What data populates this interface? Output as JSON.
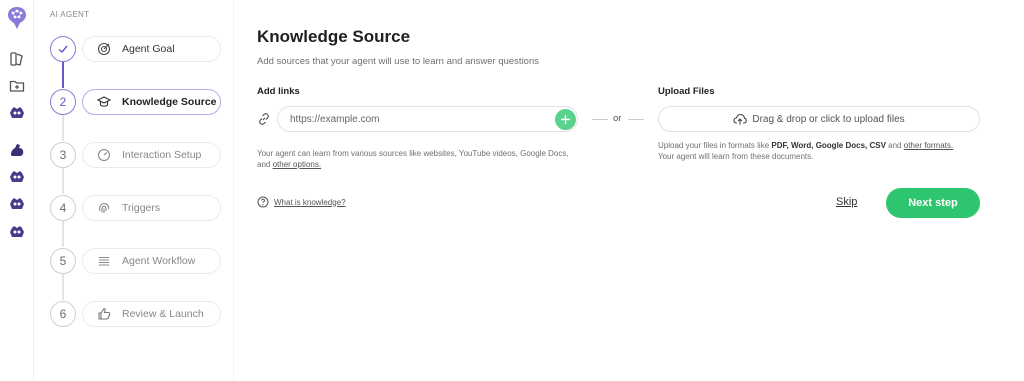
{
  "app": {
    "section_label": "AI AGENT",
    "logo_icon": "brain-logo-icon",
    "accent_color": "#6a55c9",
    "success_color": "#2ec56f"
  },
  "rail": {
    "icons": [
      "book-icon",
      "folder-plus-icon",
      "agent-avatar-icon",
      "flexed-arm-icon",
      "agent-avatar-icon",
      "agent-avatar-icon",
      "agent-avatar-icon"
    ]
  },
  "steps": [
    {
      "number": "1",
      "label": "Agent Goal",
      "icon": "target-icon",
      "status": "done"
    },
    {
      "number": "2",
      "label": "Knowledge Source",
      "icon": "graduation-cap-icon",
      "status": "active"
    },
    {
      "number": "3",
      "label": "Interaction Setup",
      "icon": "gauge-icon",
      "status": "pending"
    },
    {
      "number": "4",
      "label": "Triggers",
      "icon": "fingerprint-icon",
      "status": "pending"
    },
    {
      "number": "5",
      "label": "Agent Workflow",
      "icon": "list-icon",
      "status": "pending"
    },
    {
      "number": "6",
      "label": "Review & Launch",
      "icon": "thumbs-up-icon",
      "status": "pending"
    }
  ],
  "main": {
    "title": "Knowledge Source",
    "subtitle": "Add sources that your agent will use to learn and answer questions",
    "links": {
      "heading": "Add links",
      "placeholder": "https://example.com",
      "value": "",
      "help_text": "Your agent can learn from various sources like websites, YouTube videos, Google Docs, and",
      "help_link": "other options."
    },
    "or_label": "or",
    "upload": {
      "heading": "Upload Files",
      "button_label": "Drag & drop or click to upload files",
      "help_prefix": "Upload your files in formats like",
      "formats": "PDF, Word, Google Docs, CSV",
      "and_label": "and",
      "formats_link": "other formats.",
      "help_suffix": "Your agent will learn from these documents."
    },
    "what_is_knowledge": "What is knowledge?",
    "skip_label": "Skip",
    "next_label": "Next step"
  }
}
